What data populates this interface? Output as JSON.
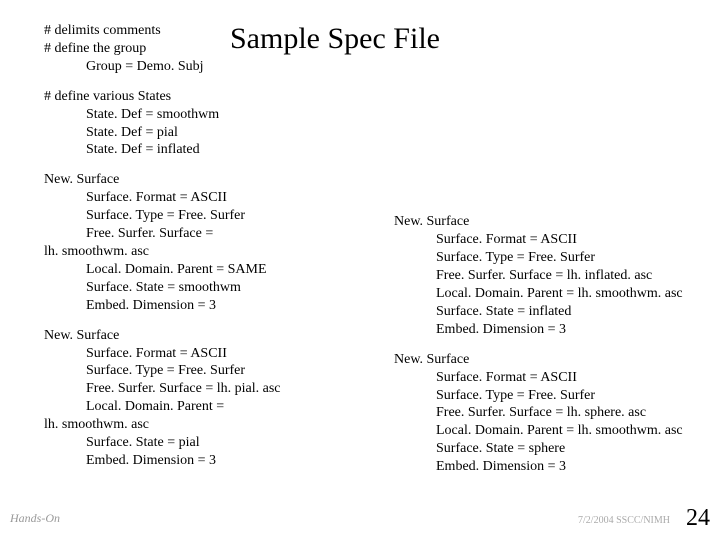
{
  "title": "Sample Spec File",
  "blocks": {
    "b1": [
      "# delimits comments",
      "# define the group",
      "Group = Demo. Subj"
    ],
    "b2": [
      "# define various States",
      "State. Def = smoothwm",
      "State. Def = pial",
      "State. Def = inflated"
    ],
    "l1": [
      "New. Surface",
      "Surface. Format = ASCII",
      "Surface. Type = Free. Surfer",
      "Free. Surfer. Surface =",
      "lh. smoothwm. asc",
      "Local. Domain. Parent = SAME",
      "Surface. State = smoothwm",
      "Embed. Dimension = 3"
    ],
    "l2": [
      "New. Surface",
      "Surface. Format = ASCII",
      "Surface. Type = Free. Surfer",
      "Free. Surfer. Surface = lh. pial. asc",
      "Local. Domain. Parent =",
      "lh. smoothwm. asc",
      "Surface. State = pial",
      "Embed. Dimension = 3"
    ],
    "r1": [
      "New. Surface",
      "Surface. Format = ASCII",
      "Surface. Type = Free. Surfer",
      "Free. Surfer. Surface = lh. inflated. asc",
      "Local. Domain. Parent = lh. smoothwm. asc",
      "Surface. State = inflated",
      "Embed. Dimension = 3"
    ],
    "r2": [
      "New. Surface",
      "Surface. Format = ASCII",
      "Surface. Type = Free. Surfer",
      "Free. Surfer. Surface = lh. sphere. asc",
      "Local. Domain. Parent = lh. smoothwm. asc",
      "Surface. State = sphere",
      "Embed. Dimension = 3"
    ]
  },
  "noindent": {
    "b1": [
      0,
      1
    ],
    "b2": [
      0
    ],
    "l1": [
      0,
      4
    ],
    "l2": [
      0,
      5
    ],
    "r1": [
      0
    ],
    "r2": [
      0
    ]
  },
  "footer_left": "Hands-On",
  "footer_right": "7/2/2004 SSCC/NIMH",
  "page_num": "24"
}
